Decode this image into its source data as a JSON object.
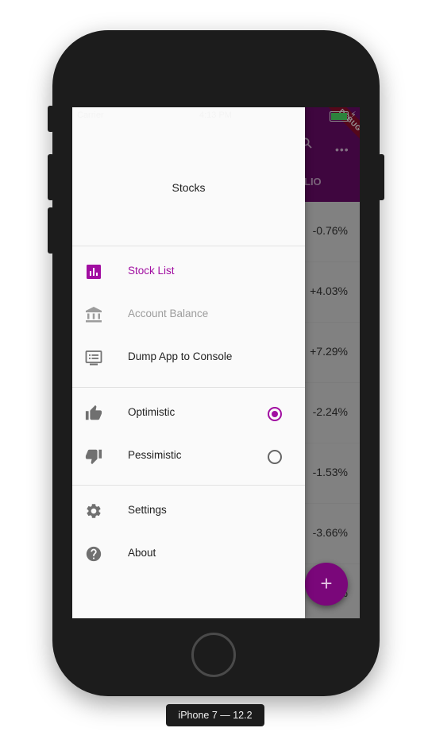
{
  "app": {
    "carrier": "Carrier",
    "time": "4:13 PM",
    "debug_banner": "DEBUG",
    "tab_fragment": "LIO",
    "more_icon": "more-horiz-icon",
    "search_icon": "search-icon"
  },
  "stocks": [
    {
      "change": "-0.76%"
    },
    {
      "change": "+4.03%"
    },
    {
      "change": "+7.29%"
    },
    {
      "change": "-2.24%"
    },
    {
      "change": "-1.53%"
    },
    {
      "change": "-3.66%"
    },
    {
      "change": "%"
    }
  ],
  "fab": {
    "label": "+"
  },
  "drawer": {
    "title": "Stocks",
    "items": [
      {
        "label": "Stock List",
        "icon": "assessment-icon",
        "state": "selected"
      },
      {
        "label": "Account Balance",
        "icon": "account-balance-icon",
        "state": "disabled"
      },
      {
        "label": "Dump App to Console",
        "icon": "dvr-icon",
        "state": "normal"
      }
    ],
    "modes": [
      {
        "label": "Optimistic",
        "icon": "thumb-up-icon",
        "selected": true
      },
      {
        "label": "Pessimistic",
        "icon": "thumb-down-icon",
        "selected": false
      }
    ],
    "footer_items": [
      {
        "label": "Settings",
        "icon": "settings-icon"
      },
      {
        "label": "About",
        "icon": "help-icon"
      }
    ]
  },
  "device": {
    "label": "iPhone 7 — 12.2"
  },
  "colors": {
    "primary": "#800080",
    "accent": "#a10ea1",
    "drawer_bg": "#fafafa"
  }
}
